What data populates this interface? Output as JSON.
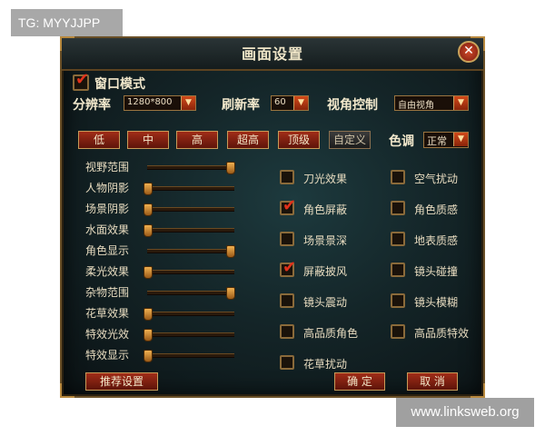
{
  "overlay": {
    "tg": "TG: MYYJJPP",
    "watermark": "www.linksweb.org"
  },
  "dialog": {
    "title": "画面设置",
    "close": "✕"
  },
  "window_mode": {
    "label": "窗口模式",
    "checked": true
  },
  "row": {
    "resolution_label": "分辨率",
    "resolution_value": "1280*800",
    "refresh_label": "刷新率",
    "refresh_value": "60",
    "view_label": "视角控制",
    "view_value": "自由视角",
    "dropdown_arrow": "▼"
  },
  "quality_presets": [
    "低",
    "中",
    "高",
    "超高",
    "顶级",
    "自定义"
  ],
  "tone": {
    "label": "色调",
    "value": "正常"
  },
  "sliders": [
    {
      "label": "视野范围",
      "level": 0.95
    },
    {
      "label": "人物阴影",
      "level": 0.0
    },
    {
      "label": "场景阴影",
      "level": 0.0
    },
    {
      "label": "水面效果",
      "level": 0.0
    },
    {
      "label": "角色显示",
      "level": 0.95
    },
    {
      "label": "柔光效果",
      "level": 0.0
    },
    {
      "label": "杂物范围",
      "level": 0.95
    },
    {
      "label": "花草效果",
      "level": 0.0
    },
    {
      "label": "特效光效",
      "level": 0.0
    },
    {
      "label": "特效显示",
      "level": 0.0
    }
  ],
  "options_left": [
    {
      "label": "刀光效果",
      "checked": false
    },
    {
      "label": "角色屏蔽",
      "checked": true
    },
    {
      "label": "场景景深",
      "checked": false
    },
    {
      "label": "屏蔽披风",
      "checked": true
    },
    {
      "label": "镜头震动",
      "checked": false
    },
    {
      "label": "高品质角色",
      "checked": false
    },
    {
      "label": "花草扰动",
      "checked": false
    }
  ],
  "options_right": [
    {
      "label": "空气扰动",
      "checked": false
    },
    {
      "label": "角色质感",
      "checked": false
    },
    {
      "label": "地表质感",
      "checked": false
    },
    {
      "label": "镜头碰撞",
      "checked": false
    },
    {
      "label": "镜头模糊",
      "checked": false
    },
    {
      "label": "高品质特效",
      "checked": false
    }
  ],
  "footer": {
    "recommend": "推荐设置",
    "confirm": "确 定",
    "cancel": "取 消"
  },
  "check_glyph": "✔"
}
